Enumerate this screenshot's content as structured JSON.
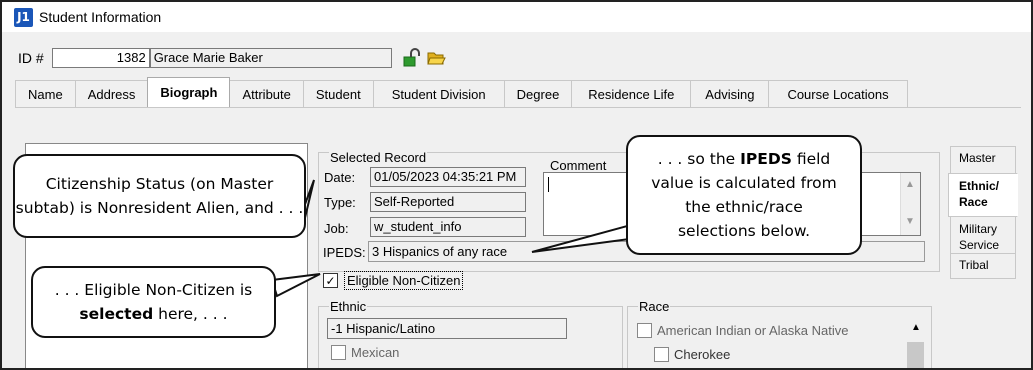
{
  "window": {
    "title": "Student Information",
    "app_icon": "J1"
  },
  "id_row": {
    "label": "ID #",
    "id_value": "1382",
    "name_value": "Grace Marie Baker"
  },
  "tabs": [
    {
      "label": "Name"
    },
    {
      "label": "Address"
    },
    {
      "label": "Biograph"
    },
    {
      "label": "Attribute"
    },
    {
      "label": "Student"
    },
    {
      "label": "Student Division"
    },
    {
      "label": "Degree"
    },
    {
      "label": "Residence Life"
    },
    {
      "label": "Advising"
    },
    {
      "label": "Course Locations"
    }
  ],
  "active_tab": "Biograph",
  "left_panel": {
    "hint": "e"
  },
  "selected_record": {
    "title": "Selected Record",
    "date_label": "Date:",
    "date_value": "01/05/2023 04:35:21 PM",
    "type_label": "Type:",
    "type_value": "Self-Reported",
    "job_label": "Job:",
    "job_value": "w_student_info",
    "comment_label": "Comment",
    "ipeds_label": "IPEDS:",
    "ipeds_value": "3  Hispanics of any race"
  },
  "eligible": {
    "label": "Eligible Non-Citizen",
    "checked": true
  },
  "ethnic": {
    "title": "Ethnic",
    "selected": "-1  Hispanic/Latino",
    "items": [
      "Mexican"
    ]
  },
  "race": {
    "title": "Race",
    "items": [
      "American Indian or Alaska Native",
      "Cherokee"
    ]
  },
  "side_tabs": [
    {
      "label": "Master"
    },
    {
      "label": "Ethnic/ Race"
    },
    {
      "label": "Military Service"
    },
    {
      "label": "Tribal"
    }
  ],
  "callouts": {
    "citizenship": "Citizenship Status (on Master subtab) is Nonresident Alien, and . . .",
    "eligible_pre": ". . . Eligible Non-Citizen is ",
    "eligible_bold": "selected",
    "eligible_post": " here, . . .",
    "ipeds_pre": ". . . so the ",
    "ipeds_bold": "IPEDS",
    "ipeds_post": " field value is calculated from the ethnic/race selections below."
  }
}
